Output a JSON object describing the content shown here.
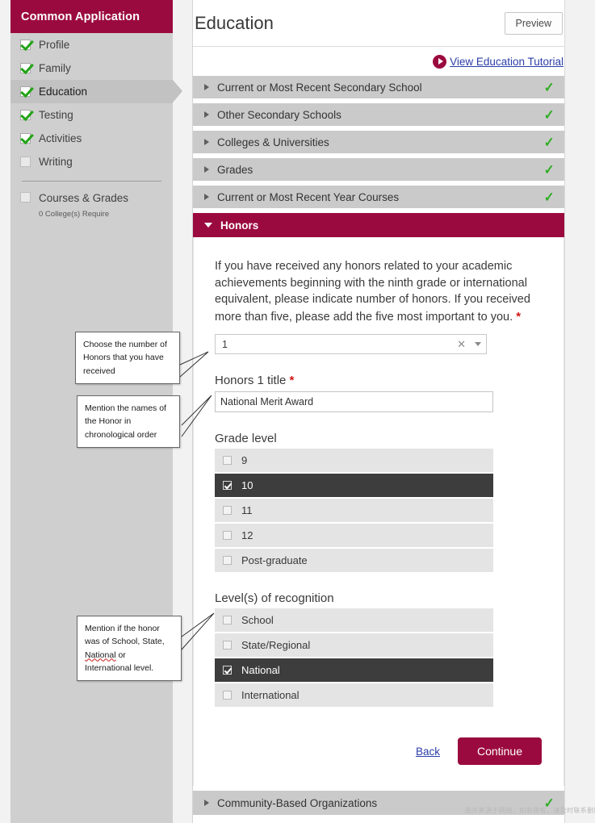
{
  "sidebar": {
    "title": "Common Application",
    "items": [
      {
        "label": "Profile",
        "state": "done"
      },
      {
        "label": "Family",
        "state": "done"
      },
      {
        "label": "Education",
        "state": "done",
        "active": true
      },
      {
        "label": "Testing",
        "state": "done"
      },
      {
        "label": "Activities",
        "state": "done"
      },
      {
        "label": "Writing",
        "state": "empty"
      }
    ],
    "courses": {
      "label": "Courses & Grades",
      "sub": "0 College(s) Require"
    }
  },
  "header": {
    "title": "Education",
    "preview_label": "Preview",
    "tutorial_link": "View Education Tutorial",
    "play_icon": "play-circle-icon"
  },
  "sections": [
    {
      "label": "Current or Most Recent Secondary School",
      "complete": true,
      "open": false
    },
    {
      "label": "Other Secondary Schools",
      "complete": true,
      "open": false
    },
    {
      "label": "Colleges & Universities",
      "complete": true,
      "open": false
    },
    {
      "label": "Grades",
      "complete": true,
      "open": false
    },
    {
      "label": "Current or Most Recent Year Courses",
      "complete": true,
      "open": false
    }
  ],
  "honors": {
    "header_label": "Honors",
    "intro": "If you have received any honors related to your academic achievements beginning with the ninth grade or international equivalent, please indicate number of honors. If you received more than five, please add the five most important to you.",
    "required_mark": "*",
    "count_select": {
      "value": "1",
      "clear_icon": "close-icon",
      "caret_icon": "chevron-down-icon"
    },
    "title_field": {
      "label": "Honors 1 title",
      "value": "National Merit Award"
    },
    "grade_level": {
      "label": "Grade level",
      "options": [
        {
          "label": "9",
          "checked": false
        },
        {
          "label": "10",
          "checked": true
        },
        {
          "label": "11",
          "checked": false
        },
        {
          "label": "12",
          "checked": false
        },
        {
          "label": "Post-graduate",
          "checked": false
        }
      ]
    },
    "recognition": {
      "label": "Level(s) of recognition",
      "options": [
        {
          "label": "School",
          "checked": false
        },
        {
          "label": "State/Regional",
          "checked": false
        },
        {
          "label": "National",
          "checked": true
        },
        {
          "label": "International",
          "checked": false
        }
      ]
    }
  },
  "actions": {
    "back_label": "Back",
    "continue_label": "Continue"
  },
  "bottom_section": {
    "label": "Community-Based Organizations",
    "complete": true
  },
  "callouts": [
    {
      "id": 1,
      "text": "Choose the number of Honors that you have received"
    },
    {
      "id": 2,
      "text": "Mention the names of the Honor in chronological order"
    },
    {
      "id": 3,
      "line1": "Mention if the honor",
      "line2": "was of School, State,",
      "line3a": "National",
      "line3b": " or",
      "line4": "International level."
    }
  ],
  "watermark": "图片来源于网络，如有侵权，请及时联系删除。"
}
